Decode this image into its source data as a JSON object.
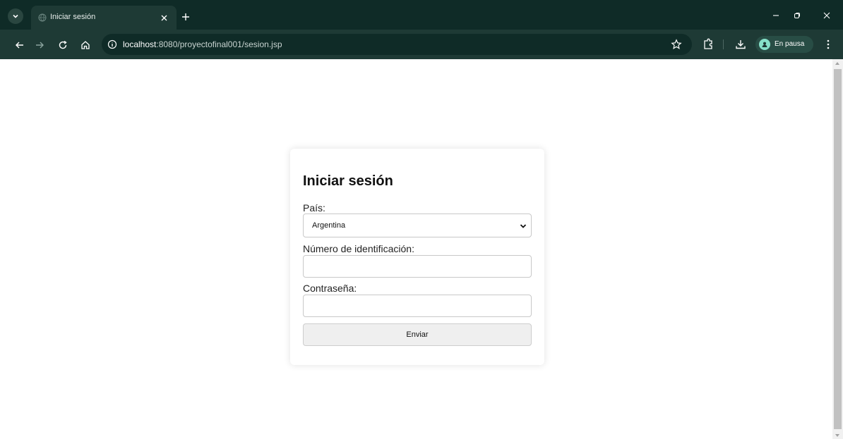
{
  "browser": {
    "tab": {
      "title": "Iniciar sesión"
    },
    "address": {
      "host": "localhost",
      "rest": ":8080/proyectofinal001/sesion.jsp"
    },
    "profile": {
      "label": "En pausa"
    }
  },
  "page": {
    "title": "Iniciar sesión",
    "country": {
      "label": "País:",
      "selected": "Argentina"
    },
    "id_number": {
      "label": "Número de identificación:",
      "value": ""
    },
    "password": {
      "label": "Contraseña:",
      "value": ""
    },
    "submit_label": "Enviar"
  },
  "colors": {
    "chrome_dark": "#0f2b27",
    "chrome_toolbar": "#1e3a35",
    "button_bg": "#efefef"
  }
}
